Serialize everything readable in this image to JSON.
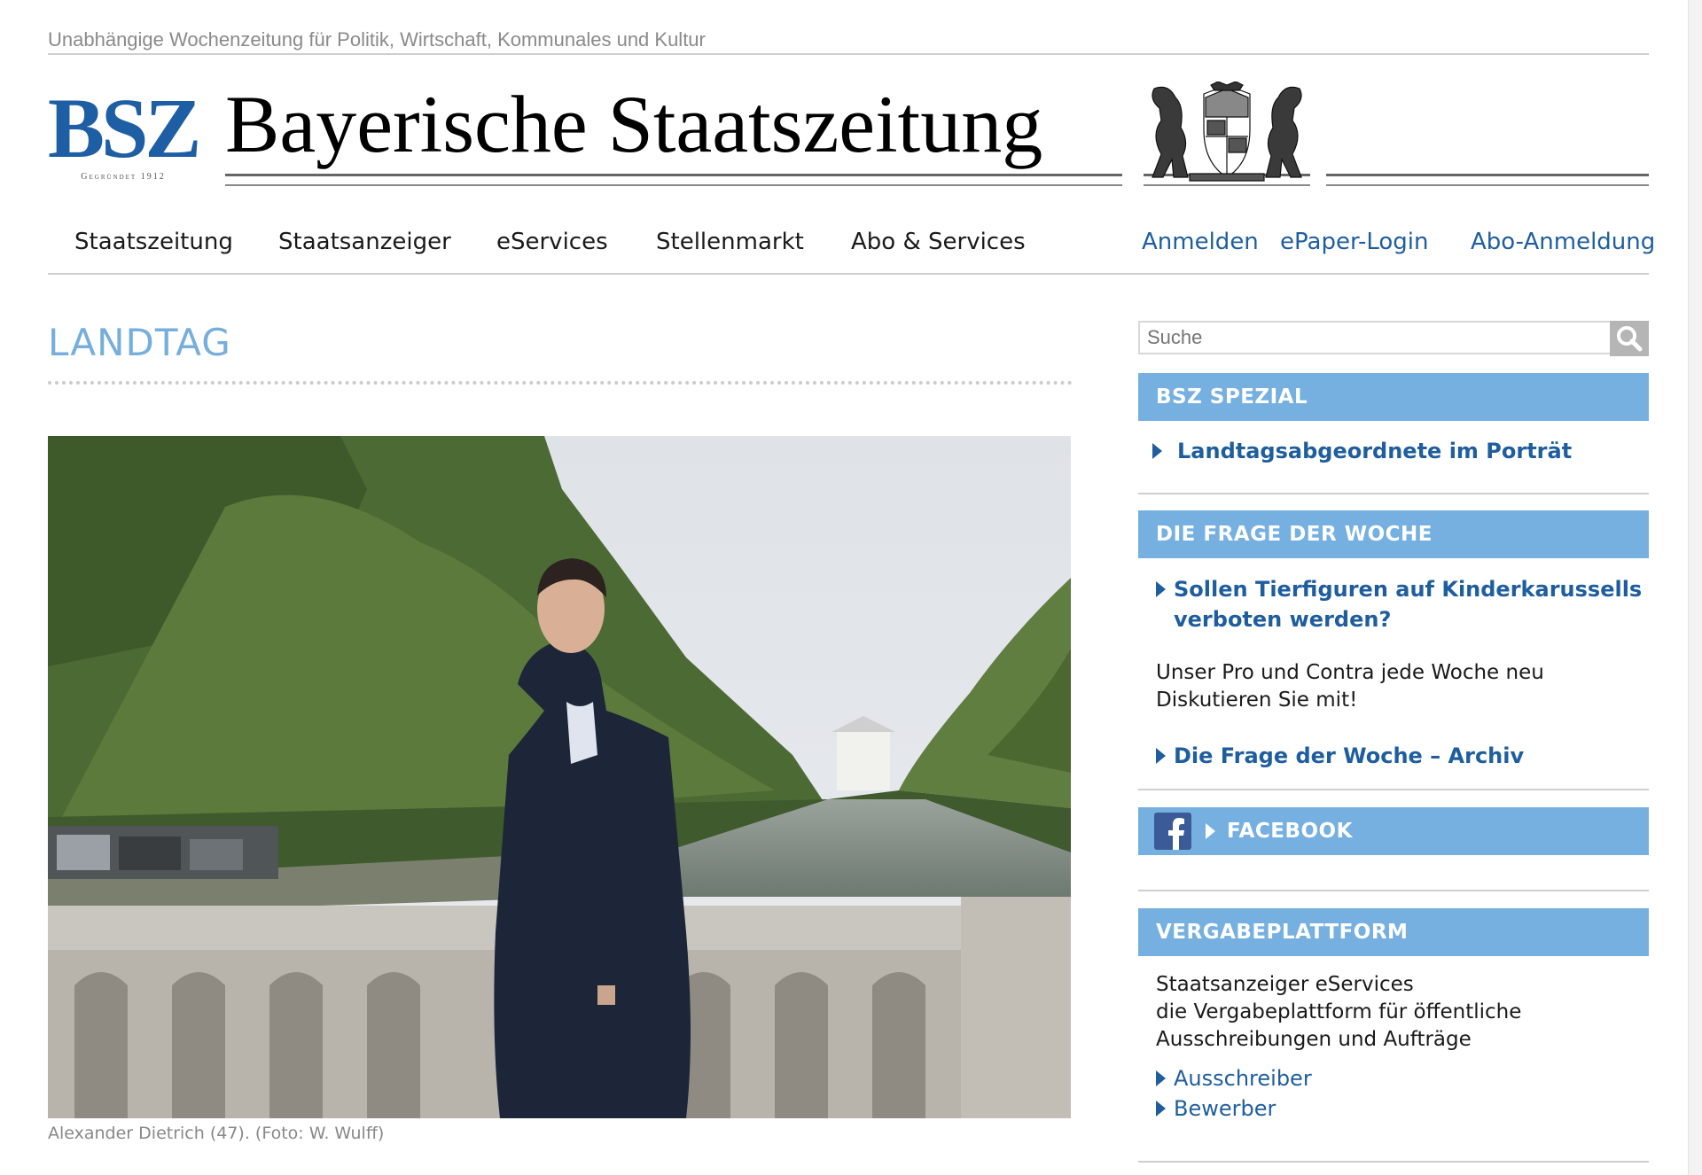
{
  "tagline": "Unabhängige Wochenzeitung für Politik, Wirtschaft, Kommunales und Kultur",
  "logo": {
    "abbr": "BSZ",
    "founded": "Gegründet 1912"
  },
  "masthead": "Bayerische Staatszeitung",
  "nav": {
    "items": [
      "Staatszeitung",
      "Staatsanzeiger",
      "eServices",
      "Stellenmarkt",
      "Abo & Services"
    ],
    "right": [
      "Anmelden",
      "ePaper-Login",
      "Abo-Anmeldung"
    ]
  },
  "section_title": "LANDTAG",
  "photo_caption": "Alexander Dietrich (47). (Foto: W. Wulff)",
  "search": {
    "placeholder": "Suche"
  },
  "sidebar": {
    "spezial": {
      "heading": "BSZ SPEZIAL",
      "link": "Landtagsabgeordnete im Porträt"
    },
    "frage": {
      "heading": "DIE FRAGE DER WOCHE",
      "question_line1": "Sollen Tierfiguren auf Kinderkarussells",
      "question_line2": "verboten werden?",
      "text_line1": "Unser Pro und Contra jede Woche neu",
      "text_line2": "Diskutieren Sie mit!",
      "archive": "Die Frage der Woche – Archiv"
    },
    "facebook": {
      "label": "FACEBOOK"
    },
    "vergabe": {
      "heading": "VERGABEPLATTFORM",
      "line1": "Staatsanzeiger eServices",
      "line2": "die Vergabeplattform für öffentliche",
      "line3": "Ausschreibungen und Aufträge",
      "link1": "Ausschreiber",
      "link2": "Bewerber"
    }
  },
  "colors": {
    "accent": "#76b0e0",
    "link": "#1f5e9e",
    "logo": "#1e5ea4",
    "title": "#76aedc"
  }
}
